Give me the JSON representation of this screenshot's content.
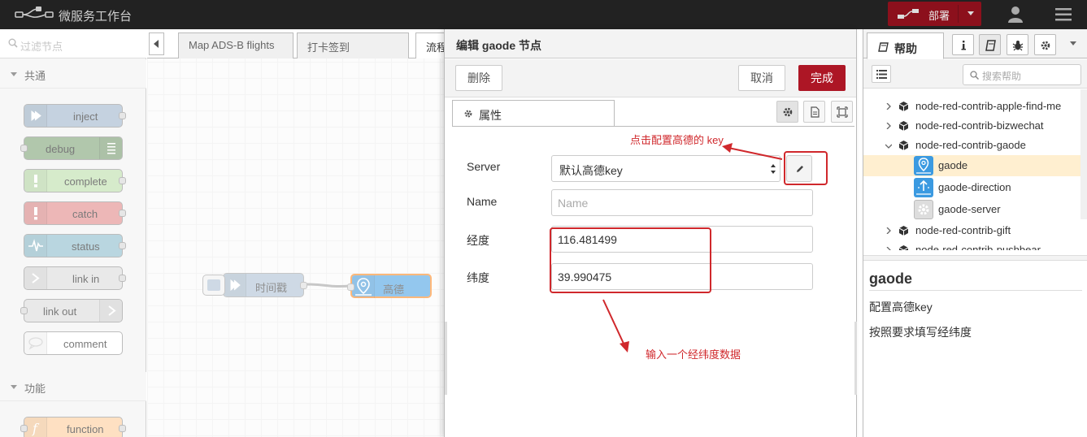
{
  "header": {
    "title": "微服务工作台",
    "deploy_label": "部署"
  },
  "palette": {
    "filter_placeholder": "过滤节点",
    "categories": [
      {
        "label": "共通"
      },
      {
        "label": "功能"
      }
    ],
    "nodes": [
      {
        "label": "inject",
        "color": "#a6bbcf"
      },
      {
        "label": "debug",
        "color": "#87a980"
      },
      {
        "label": "complete",
        "color": "#c0deed"
      },
      {
        "label": "catch",
        "color": "#e49191"
      },
      {
        "label": "status",
        "color": "#94c1d0"
      },
      {
        "label": "link in",
        "color": "#dddddd"
      },
      {
        "label": "link out",
        "color": "#dddddd"
      },
      {
        "label": "comment",
        "color": "#ffffff"
      },
      {
        "label": "function",
        "color": "#fdd0a2"
      }
    ]
  },
  "workspace": {
    "tabs": [
      {
        "label": "Map ADS-B flights"
      },
      {
        "label": "打卡签到"
      },
      {
        "label": "流程"
      }
    ],
    "flow_nodes": [
      {
        "label": "时间戳",
        "color": "#a6bbcf"
      },
      {
        "label": "高德",
        "color": "#3b9ae1"
      }
    ]
  },
  "tray": {
    "title": "编辑 gaode 节点",
    "delete_label": "删除",
    "cancel_label": "取消",
    "done_label": "完成",
    "tab_label": "属性",
    "fields": {
      "server_label": "Server",
      "server_value": "默认高德key",
      "name_label": "Name",
      "name_placeholder": "Name",
      "lng_label": "经度",
      "lng_value": "116.481499",
      "lat_label": "纬度",
      "lat_value": "39.990475"
    }
  },
  "annotations": {
    "key_hint": "点击配置高德的 key",
    "input_hint": "输入一个经纬度数据",
    "color": "#d0282c"
  },
  "sidebar": {
    "tab_label": "帮助",
    "search_placeholder": "搜索帮助",
    "tree": [
      {
        "label": "node-red-contrib-apple-find-me"
      },
      {
        "label": "node-red-contrib-bizwechat"
      },
      {
        "label": "node-red-contrib-gaode"
      },
      {
        "label": "gaode"
      },
      {
        "label": "gaode-direction"
      },
      {
        "label": "gaode-server"
      },
      {
        "label": "node-red-contrib-gift"
      },
      {
        "label": "node-red-contrib-pushbear"
      }
    ],
    "help": {
      "title": "gaode",
      "lines": [
        "配置高德key",
        "按照要求填写经纬度"
      ]
    }
  },
  "colors": {
    "header_bg": "#222222",
    "deploy_bg": "#8c101c",
    "primary_button": "#ad1625",
    "selected_row": "#ffefd0"
  }
}
